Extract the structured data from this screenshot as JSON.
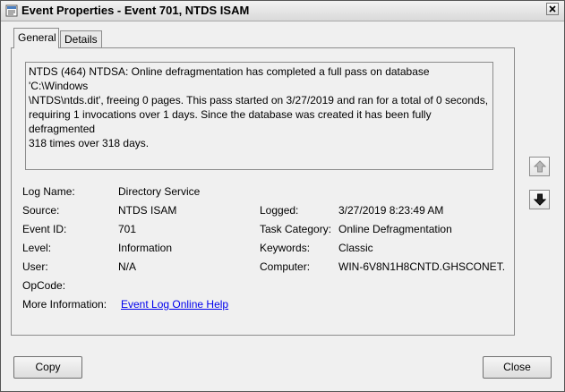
{
  "window": {
    "title": "Event Properties - Event 701, NTDS ISAM"
  },
  "tabs": [
    {
      "label": "General",
      "active": true
    },
    {
      "label": "Details",
      "active": false
    }
  ],
  "description": "NTDS (464) NTDSA: Online defragmentation has completed a full pass on database 'C:\\Windows\n\\NTDS\\ntds.dit', freeing 0 pages. This pass started on 3/27/2019 and ran for a total of 0 seconds,\nrequiring 1 invocations over 1 days. Since the database was created it has been fully defragmented\n318 times over 318 days.",
  "fields": {
    "log_name": {
      "label": "Log Name:",
      "value": "Directory Service"
    },
    "source": {
      "label": "Source:",
      "value": "NTDS ISAM"
    },
    "logged": {
      "label": "Logged:",
      "value": "3/27/2019 8:23:49 AM"
    },
    "event_id": {
      "label": "Event ID:",
      "value": "701"
    },
    "task_category": {
      "label": "Task Category:",
      "value": "Online Defragmentation"
    },
    "level": {
      "label": "Level:",
      "value": "Information"
    },
    "keywords": {
      "label": "Keywords:",
      "value": "Classic"
    },
    "user": {
      "label": "User:",
      "value": "N/A"
    },
    "computer": {
      "label": "Computer:",
      "value": "WIN-6V8N1H8CNTD.GHSCONET."
    },
    "opcode": {
      "label": "OpCode:",
      "value": ""
    },
    "more_info": {
      "label": "More Information:",
      "link": "Event Log Online Help"
    }
  },
  "buttons": {
    "copy": "Copy",
    "close": "Close"
  },
  "icons": {
    "app": "event-viewer-icon",
    "close": "close-x-icon",
    "up": "arrow-up-icon",
    "down": "arrow-down-icon"
  },
  "colors": {
    "link": "#0000ee",
    "window_bg": "#f0f0f0"
  }
}
